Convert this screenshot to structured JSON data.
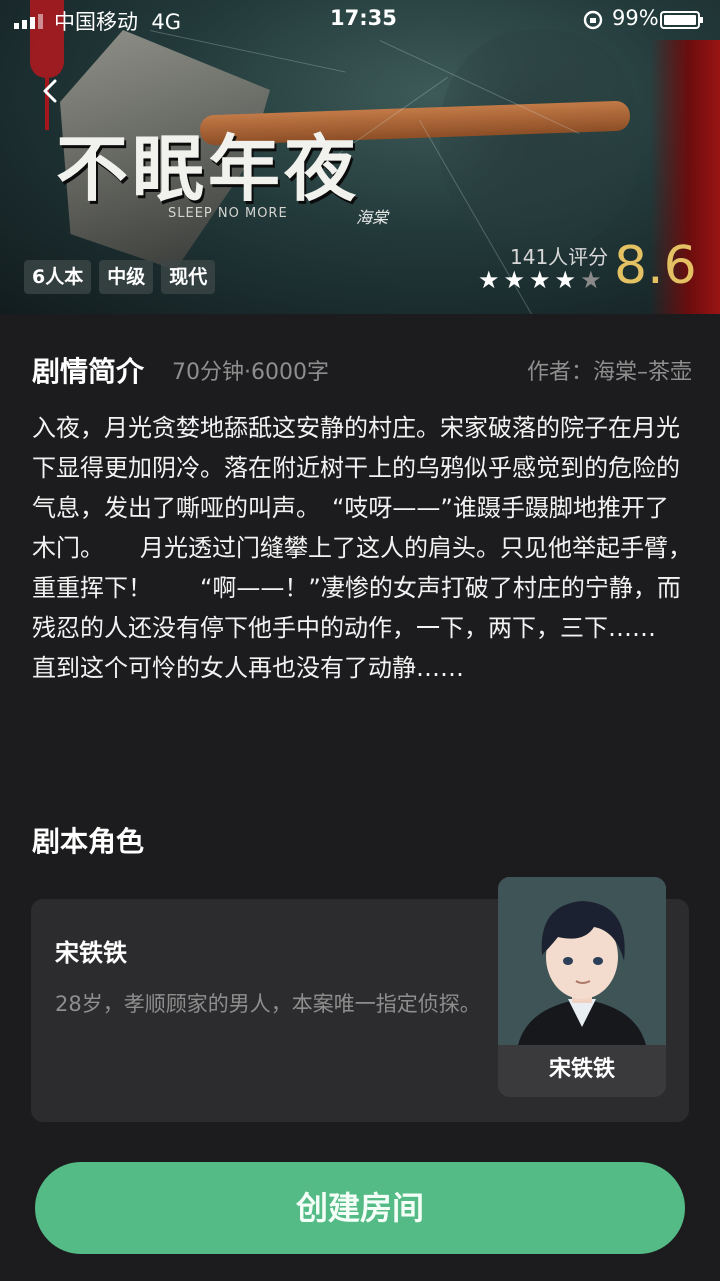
{
  "status_bar": {
    "carrier": "中国移动",
    "network": "4G",
    "time": "17:35",
    "battery": "99%"
  },
  "banner": {
    "title": "不眠年夜",
    "subtitle_en": "SLEEP NO MORE",
    "signature": "海棠",
    "tags": [
      "6人本",
      "中级",
      "现代"
    ],
    "rating_count": "141人评分",
    "stars_filled": 4,
    "stars_total": 5,
    "score": "8.6"
  },
  "synopsis": {
    "title": "剧情简介",
    "meta": "70分钟·6000字",
    "author": "作者：海棠–茶壶",
    "text": "入夜，月光贪婪地舔舐这安静的村庄。宋家破落的院子在月光下显得更加阴冷。落在附近树干上的乌鸦似乎感觉到的危险的气息，发出了嘶哑的叫声。　“吱呀——”谁蹑手蹑脚地推开了木门。　　月光透过门缝攀上了这人的肩头。只见他举起手臂，重重挥下！　　“啊——！”凄惨的女声打破了村庄的宁静，而残忍的人还没有停下他手中的动作，一下，两下，三下……　　直到这个可怜的女人再也没有了动静……"
  },
  "roles": {
    "title": "剧本角色",
    "items": [
      {
        "name": "宋铁铁",
        "description": "28岁，孝顺顾家的男人，本案唯一指定侦探。",
        "avatar_label": "宋铁铁"
      }
    ]
  },
  "actions": {
    "create_room": "创建房间"
  },
  "colors": {
    "background": "#1c1c1e",
    "card": "#2c2c2e",
    "accent_green": "#55bb86",
    "score_gold": "#e4c163",
    "muted_text": "#8e8e8e"
  },
  "icons": {
    "back": "chevron-left-icon",
    "star": "star-icon"
  }
}
